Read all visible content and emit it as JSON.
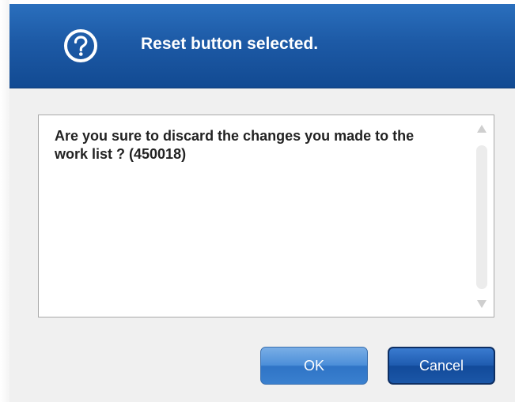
{
  "dialog": {
    "title": "Reset button selected.",
    "icon": "question-circle-icon",
    "message": "Are you sure to discard the changes you made to the work list ? (450018)"
  },
  "buttons": {
    "ok_label": "OK",
    "cancel_label": "Cancel"
  },
  "colors": {
    "title_bar": "#1d5aa6",
    "dialog_background": "#f0f0f0",
    "ok_button": "#4c8fd9",
    "cancel_button": "#1f5cb0"
  }
}
